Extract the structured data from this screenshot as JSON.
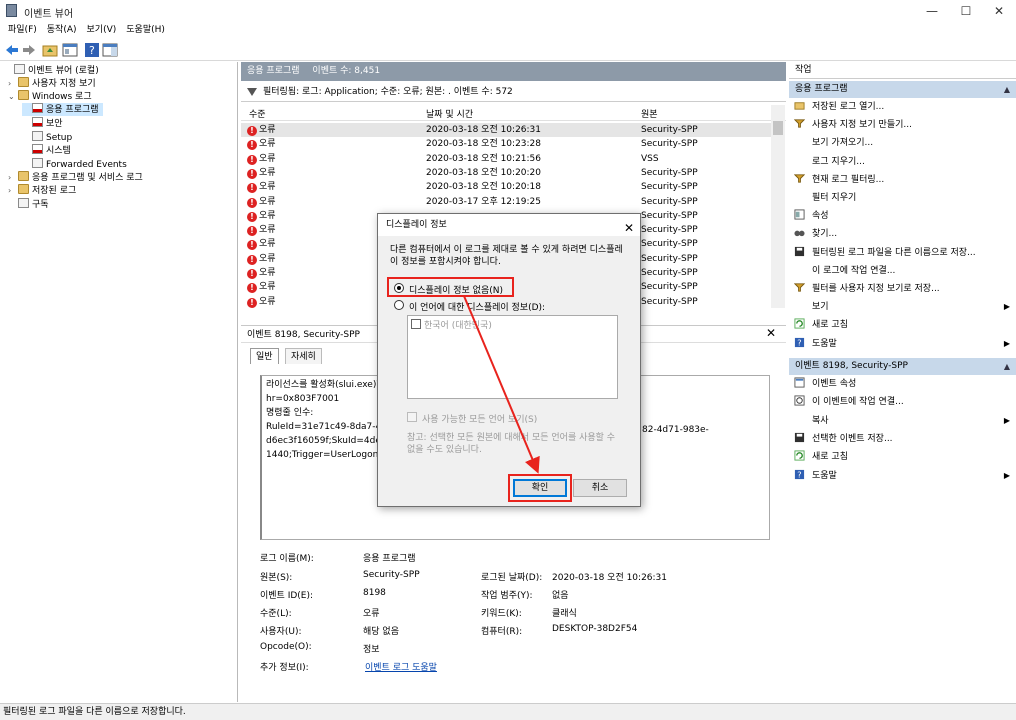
{
  "window": {
    "title": "이벤트 뷰어",
    "controls": {
      "minimize": "—",
      "maximize": "☐",
      "close": "✕"
    }
  },
  "menu": [
    "파일(F)",
    "동작(A)",
    "보기(V)",
    "도움말(H)"
  ],
  "tree": [
    {
      "label": "이벤트 뷰어 (로컬)",
      "level": 0,
      "expand": "",
      "icon": "event-viewer-icon"
    },
    {
      "label": "사용자 지정 보기",
      "level": 1,
      "expand": "›",
      "icon": "folder-icon"
    },
    {
      "label": "Windows 로그",
      "level": 1,
      "expand": "⌄",
      "icon": "folder-icon"
    },
    {
      "label": "응용 프로그램",
      "level": 2,
      "expand": "",
      "icon": "log-icon",
      "selected": true
    },
    {
      "label": "보안",
      "level": 2,
      "expand": "",
      "icon": "log-icon"
    },
    {
      "label": "Setup",
      "level": 2,
      "expand": "",
      "icon": "log-icon"
    },
    {
      "label": "시스템",
      "level": 2,
      "expand": "",
      "icon": "log-icon"
    },
    {
      "label": "Forwarded Events",
      "level": 2,
      "expand": "",
      "icon": "log-icon"
    },
    {
      "label": "응용 프로그램 및 서비스 로그",
      "level": 1,
      "expand": "›",
      "icon": "folder-icon"
    },
    {
      "label": "저장된 로그",
      "level": 1,
      "expand": "›",
      "icon": "folder-icon"
    },
    {
      "label": "구독",
      "level": 1,
      "expand": "",
      "icon": "subscription-icon"
    }
  ],
  "main": {
    "header_title": "응용 프로그램",
    "header_count": "이벤트 수: 8,451",
    "filter_text": "필터링됨: 로그: Application; 수준: 오류; 원본: . 이벤트 수: 572",
    "columns": [
      "수준",
      "날짜 및 시간",
      "원본"
    ],
    "rows": [
      {
        "level": "오류",
        "datetime": "2020-03-18 오전 10:26:31",
        "source": "Security-SPP"
      },
      {
        "level": "오류",
        "datetime": "2020-03-18 오전 10:23:28",
        "source": "Security-SPP"
      },
      {
        "level": "오류",
        "datetime": "2020-03-18 오전 10:21:56",
        "source": "VSS"
      },
      {
        "level": "오류",
        "datetime": "2020-03-18 오전 10:20:20",
        "source": "Security-SPP"
      },
      {
        "level": "오류",
        "datetime": "2020-03-18 오전 10:20:18",
        "source": "Security-SPP"
      },
      {
        "level": "오류",
        "datetime": "2020-03-17 오후 12:19:25",
        "source": "Security-SPP"
      },
      {
        "level": "오류",
        "datetime": "",
        "source": "Security-SPP"
      },
      {
        "level": "오류",
        "datetime": "",
        "source": "Security-SPP"
      },
      {
        "level": "오류",
        "datetime": "",
        "source": "Security-SPP"
      },
      {
        "level": "오류",
        "datetime": "",
        "source": "Security-SPP"
      },
      {
        "level": "오류",
        "datetime": "",
        "source": "Security-SPP"
      },
      {
        "level": "오류",
        "datetime": "",
        "source": "Security-SPP"
      },
      {
        "level": "오류",
        "datetime": "",
        "source": "Security-SPP"
      }
    ]
  },
  "detail": {
    "title": "이벤트 8198, Security-SPP",
    "close": "✕",
    "tabs": [
      "일반",
      "자세히"
    ],
    "description": [
      "라이선스를 활성화(slui.exe)하",
      "hr=0x803F7001",
      "명령줄 인수:",
      "RuleId=31e71c49-8da7-4a2",
      "d6ec3f16059f;SkuId=4de7c",
      "1440;Trigger=UserLogon;Ses"
    ],
    "description_tail": "82-4d71-983e-",
    "props": {
      "log_name_label": "로그 이름(M):",
      "log_name": "응용 프로그램",
      "source_label": "원본(S):",
      "source": "Security-SPP",
      "logged_label": "로그된 날짜(D):",
      "logged": "2020-03-18 오전 10:26:31",
      "event_id_label": "이벤트 ID(E):",
      "event_id": "8198",
      "task_label": "작업 범주(Y):",
      "task": "없음",
      "level_label": "수준(L):",
      "level": "오류",
      "keywords_label": "키워드(K):",
      "keywords": "클래식",
      "user_label": "사용자(U):",
      "user": "해당 없음",
      "computer_label": "컴퓨터(R):",
      "computer": "DESKTOP-38D2F54",
      "opcode_label": "Opcode(O):",
      "opcode": "정보",
      "more_info_label": "추가 정보(I):",
      "more_info": "이벤트 로그 도움말"
    }
  },
  "actions": {
    "header": "작업",
    "section1": {
      "title": "응용 프로그램",
      "items": [
        {
          "label": "저장된 로그 열기...",
          "icon": "open-folder-icon",
          "submenu": false
        },
        {
          "label": "사용자 지정 보기 만들기...",
          "icon": "filter-icon",
          "submenu": false
        },
        {
          "label": "보기 가져오기...",
          "icon": "",
          "submenu": false
        },
        {
          "label": "로그 지우기...",
          "icon": "",
          "submenu": false
        },
        {
          "label": "현재 로그 필터링...",
          "icon": "filter-icon",
          "submenu": false
        },
        {
          "label": "필터 지우기",
          "icon": "",
          "submenu": false
        },
        {
          "label": "속성",
          "icon": "properties-icon",
          "submenu": false
        },
        {
          "label": "찾기...",
          "icon": "binoculars-icon",
          "submenu": false
        },
        {
          "label": "필터링된 로그 파일을 다른 이름으로 저장...",
          "icon": "save-icon",
          "submenu": false
        },
        {
          "label": "이 로그에 작업 연결...",
          "icon": "",
          "submenu": false
        },
        {
          "label": "필터를 사용자 지정 보기로 저장...",
          "icon": "filter-save-icon",
          "submenu": false
        },
        {
          "label": "보기",
          "icon": "",
          "submenu": true
        },
        {
          "label": "새로 고침",
          "icon": "refresh-icon",
          "submenu": false
        },
        {
          "label": "도움말",
          "icon": "help-icon",
          "submenu": true
        }
      ]
    },
    "section2": {
      "title": "이벤트 8198, Security-SPP",
      "items": [
        {
          "label": "이벤트 속성",
          "icon": "event-properties-icon",
          "submenu": false
        },
        {
          "label": "이 이벤트에 작업 연결...",
          "icon": "task-icon",
          "submenu": false
        },
        {
          "label": "복사",
          "icon": "",
          "submenu": true
        },
        {
          "label": "선택한 이벤트 저장...",
          "icon": "save-icon",
          "submenu": false
        },
        {
          "label": "새로 고침",
          "icon": "refresh-icon",
          "submenu": false
        },
        {
          "label": "도움말",
          "icon": "help-icon",
          "submenu": true
        }
      ]
    }
  },
  "dialog": {
    "title": "디스플레이 정보",
    "close": "✕",
    "message": "다른 컴퓨터에서 이 로그를 제대로 볼 수 있게 하려면 디스플레이 정보를 포함시켜야 합니다.",
    "option1": "디스플레이 정보 없음(N)",
    "option2": "이 언어에 대한 디스플레이 정보(D):",
    "language_item": "한국어 (대한민국)",
    "all_languages": "사용 가능한 모든 언어 보기(S)",
    "note": "참고: 선택한 모든 원본에 대해서 모든 언어를 사용할 수 없을 수도 있습니다.",
    "ok": "확인",
    "cancel": "취소",
    "selected_option": "option1"
  },
  "status": "필터링된 로그 파일을 다른 이름으로 저장합니다.",
  "colors": {
    "annotation": "#e8231d",
    "header_bg": "#8d9aa8",
    "section_bg": "#c7d8ea",
    "selection": "#cce8ff"
  }
}
